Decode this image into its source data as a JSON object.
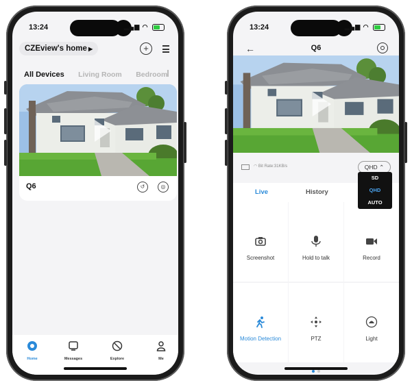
{
  "left_phone": {
    "status": {
      "time": "13:24"
    },
    "home_name": "CZEview's home",
    "tabs": [
      "All Devices",
      "Living Room",
      "Bedroom"
    ],
    "device": {
      "name": "Q6"
    },
    "bottom_nav": [
      {
        "label": "Home",
        "icon": "home-icon",
        "active": true
      },
      {
        "label": "Messages",
        "icon": "messages-icon",
        "active": false
      },
      {
        "label": "Explore",
        "icon": "explore-icon",
        "active": false
      },
      {
        "label": "Me",
        "icon": "person-icon",
        "active": false
      }
    ]
  },
  "right_phone": {
    "status": {
      "time": "13:24"
    },
    "title": "Q6",
    "bitrate": "Bit Rate:31KB/s",
    "quality": "QHD",
    "quality_options": [
      "SD",
      "QHD",
      "AUTO"
    ],
    "quality_selected": "QHD",
    "tabs": [
      "Live",
      "History"
    ],
    "controls": [
      {
        "label": "Screenshot",
        "icon": "camera-icon"
      },
      {
        "label": "Hold to talk",
        "icon": "microphone-icon"
      },
      {
        "label": "Record",
        "icon": "video-camera-icon"
      },
      {
        "label": "Motion Detection",
        "icon": "running-person-icon",
        "active": true
      },
      {
        "label": "PTZ",
        "icon": "ptz-dpad-icon"
      },
      {
        "label": "Light",
        "icon": "light-icon"
      }
    ]
  },
  "colors": {
    "accent": "#2a8ad9",
    "screen_bg": "#f4f4f6",
    "frame": "#1b1b1b"
  }
}
